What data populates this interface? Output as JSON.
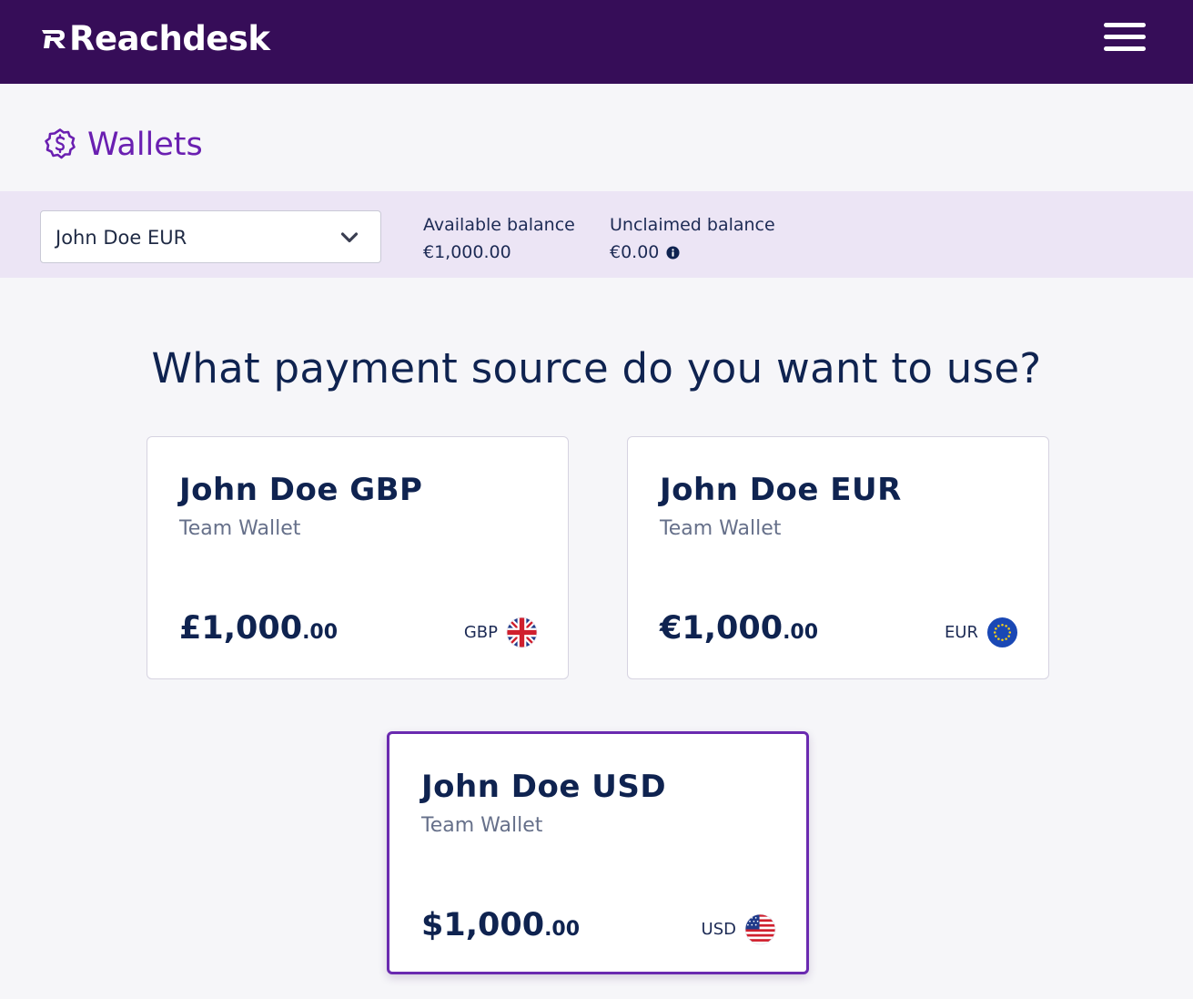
{
  "brand": {
    "name": "Reachdesk"
  },
  "header": {
    "menu_icon": "hamburger-menu-icon"
  },
  "page": {
    "title": "Wallets",
    "icon": "dollar-badge-icon"
  },
  "balance_bar": {
    "selected_wallet": "John Doe EUR",
    "available": {
      "label": "Available balance",
      "value": "€1,000.00"
    },
    "unclaimed": {
      "label": "Unclaimed balance",
      "value": "€0.00"
    }
  },
  "question": "What payment source do you want to use?",
  "cards": [
    {
      "name": "John Doe GBP",
      "type": "Team Wallet",
      "amount_main": "£1,000",
      "amount_cents": ".00",
      "currency": "GBP",
      "flag": "uk-flag-icon"
    },
    {
      "name": "John Doe EUR",
      "type": "Team Wallet",
      "amount_main": "€1,000",
      "amount_cents": ".00",
      "currency": "EUR",
      "flag": "eu-flag-icon"
    },
    {
      "name": "John Doe USD",
      "type": "Team Wallet",
      "amount_main": "$1,000",
      "amount_cents": ".00",
      "currency": "USD",
      "flag": "us-flag-icon",
      "selected": true
    }
  ],
  "colors": {
    "topbar": "#360d58",
    "accent": "#6a1fb1",
    "balance_bar": "#ece5f5",
    "text_dark": "#0f2350"
  }
}
